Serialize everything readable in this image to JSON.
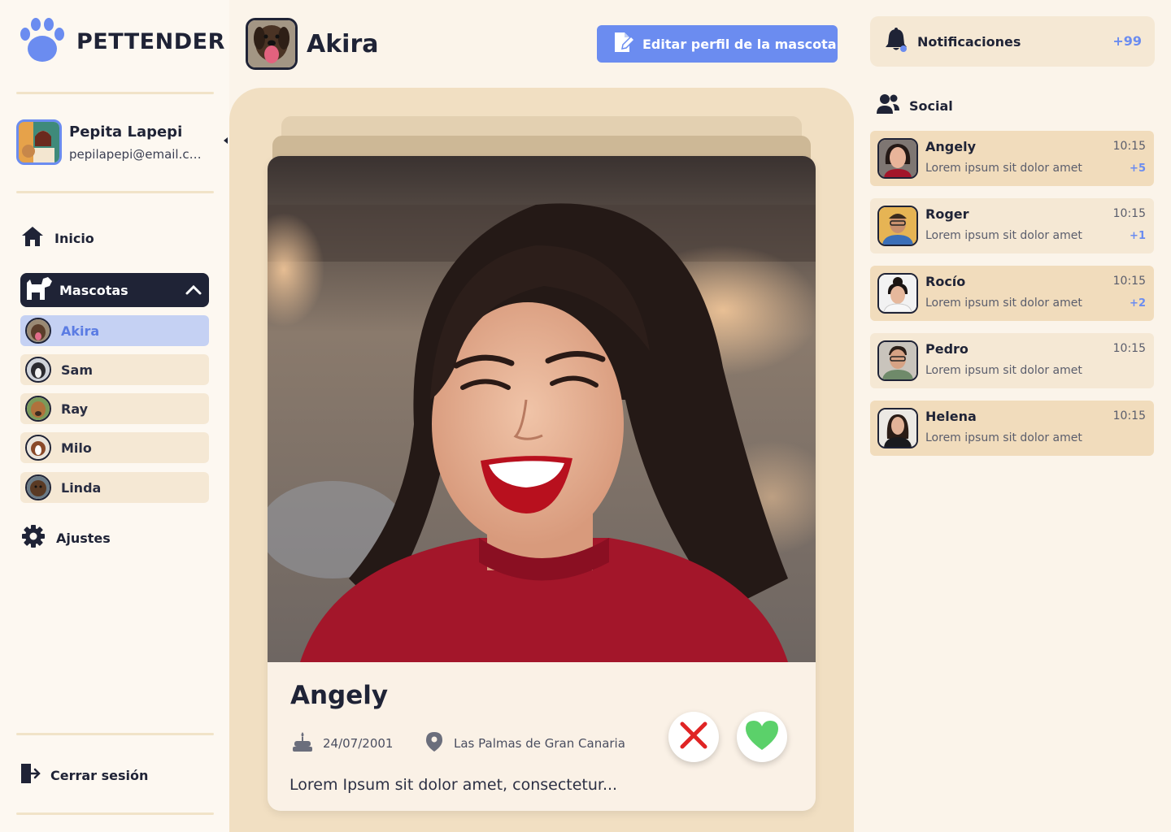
{
  "app": {
    "name": "PETTENDER"
  },
  "user": {
    "name": "Pepita Lapepi",
    "email": "pepilapepi@email.com"
  },
  "nav": {
    "home": "Inicio",
    "pets": "Mascotas",
    "settings": "Ajustes",
    "logout": "Cerrar sesión"
  },
  "pets": [
    {
      "name": "Akira",
      "active": true
    },
    {
      "name": "Sam",
      "active": false
    },
    {
      "name": "Ray",
      "active": false
    },
    {
      "name": "Milo",
      "active": false
    },
    {
      "name": "Linda",
      "active": false
    }
  ],
  "header": {
    "pet_name": "Akira",
    "edit_label": "Editar perfil de la mascota"
  },
  "profile_card": {
    "name": "Angely",
    "birthdate": "24/07/2001",
    "location": "Las Palmas de Gran Canaria",
    "description": "Lorem Ipsum sit dolor amet, consectetur..."
  },
  "notifications": {
    "label": "Notificaciones",
    "count": "+99"
  },
  "social": {
    "label": "Social",
    "chats": [
      {
        "name": "Angely",
        "message": "Lorem ipsum sit dolor amet",
        "time": "10:15",
        "badge": "+5",
        "unread": true
      },
      {
        "name": "Roger",
        "message": "Lorem ipsum sit dolor amet",
        "time": "10:15",
        "badge": "+1",
        "unread": false
      },
      {
        "name": "Rocío",
        "message": "Lorem ipsum sit dolor amet",
        "time": "10:15",
        "badge": "+2",
        "unread": true
      },
      {
        "name": "Pedro",
        "message": "Lorem ipsum sit dolor amet",
        "time": "10:15",
        "badge": "",
        "unread": false
      },
      {
        "name": "Helena",
        "message": "Lorem ipsum sit dolor amet",
        "time": "10:15",
        "badge": "",
        "unread": true
      }
    ]
  },
  "colors": {
    "accent": "#6b8cf0",
    "dark": "#1f2336",
    "reject": "#e02424",
    "like": "#5bd16a"
  }
}
